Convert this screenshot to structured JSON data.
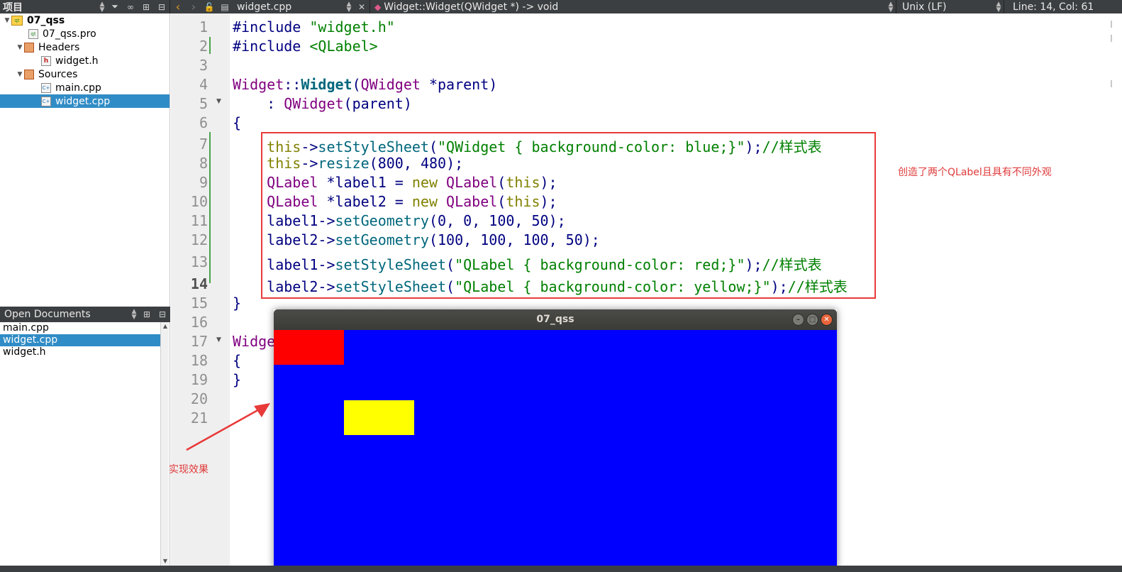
{
  "toolbar": {
    "project_title": "项目",
    "file_name": "widget.cpp",
    "function_signature": "Widget::Widget(QWidget *) -> void",
    "line_ending": "Unix (LF)",
    "cursor_position": "Line: 14, Col: 61"
  },
  "project_tree": {
    "items": [
      {
        "label": "07_qss",
        "level": 0,
        "expanded": true,
        "kind": "project",
        "bold": true
      },
      {
        "label": "07_qss.pro",
        "level": 1,
        "kind": "pro"
      },
      {
        "label": "Headers",
        "level": 1,
        "expanded": true,
        "kind": "folder"
      },
      {
        "label": "widget.h",
        "level": 2,
        "kind": "header"
      },
      {
        "label": "Sources",
        "level": 1,
        "expanded": true,
        "kind": "folder"
      },
      {
        "label": "main.cpp",
        "level": 2,
        "kind": "source"
      },
      {
        "label": "widget.cpp",
        "level": 2,
        "kind": "source",
        "selected": true
      }
    ]
  },
  "open_documents": {
    "title": "Open Documents",
    "items": [
      {
        "label": "main.cpp"
      },
      {
        "label": "widget.cpp",
        "selected": true
      },
      {
        "label": "widget.h"
      }
    ]
  },
  "editor": {
    "current_line": 14,
    "lines": [
      {
        "n": "1",
        "tokens": [
          [
            "macro",
            "#include "
          ],
          [
            "str",
            "\"widget.h\""
          ]
        ]
      },
      {
        "n": "2",
        "tokens": [
          [
            "macro",
            "#include "
          ],
          [
            "str",
            "<QLabel>"
          ]
        ]
      },
      {
        "n": "3",
        "tokens": []
      },
      {
        "n": "4",
        "tokens": [
          [
            "type",
            "Widget"
          ],
          [
            "plain",
            "::"
          ],
          [
            "fnb",
            "Widget"
          ],
          [
            "plain",
            "("
          ],
          [
            "type",
            "QWidget"
          ],
          [
            "plain",
            " *parent)"
          ]
        ]
      },
      {
        "n": "5",
        "tokens": [
          [
            "plain",
            "    : "
          ],
          [
            "type",
            "QWidget"
          ],
          [
            "plain",
            "(parent)"
          ]
        ]
      },
      {
        "n": "6",
        "tokens": [
          [
            "plain",
            "{"
          ]
        ]
      },
      {
        "n": "7",
        "tokens": [
          [
            "kw",
            "    this"
          ],
          [
            "plain",
            "->"
          ],
          [
            "fn",
            "setStyleSheet"
          ],
          [
            "plain",
            "("
          ],
          [
            "str",
            "\"QWidget { background-color: blue;}\""
          ],
          [
            "plain",
            ");"
          ],
          [
            "cm",
            "//样式表"
          ]
        ]
      },
      {
        "n": "8",
        "tokens": [
          [
            "kw",
            "    this"
          ],
          [
            "plain",
            "->"
          ],
          [
            "fn",
            "resize"
          ],
          [
            "plain",
            "("
          ],
          [
            "num",
            "800"
          ],
          [
            "plain",
            ", "
          ],
          [
            "num",
            "480"
          ],
          [
            "plain",
            ");"
          ]
        ]
      },
      {
        "n": "9",
        "tokens": [
          [
            "type",
            "    QLabel"
          ],
          [
            "plain",
            " *label1 = "
          ],
          [
            "kw",
            "new "
          ],
          [
            "type",
            "QLabel"
          ],
          [
            "plain",
            "("
          ],
          [
            "kw",
            "this"
          ],
          [
            "plain",
            ");"
          ]
        ]
      },
      {
        "n": "10",
        "tokens": [
          [
            "type",
            "    QLabel"
          ],
          [
            "plain",
            " *label2 = "
          ],
          [
            "kw",
            "new "
          ],
          [
            "type",
            "QLabel"
          ],
          [
            "plain",
            "("
          ],
          [
            "kw",
            "this"
          ],
          [
            "plain",
            ");"
          ]
        ]
      },
      {
        "n": "11",
        "tokens": [
          [
            "plain",
            "    label1->"
          ],
          [
            "fn",
            "setGeometry"
          ],
          [
            "plain",
            "("
          ],
          [
            "num",
            "0"
          ],
          [
            "plain",
            ", "
          ],
          [
            "num",
            "0"
          ],
          [
            "plain",
            ", "
          ],
          [
            "num",
            "100"
          ],
          [
            "plain",
            ", "
          ],
          [
            "num",
            "50"
          ],
          [
            "plain",
            ");"
          ]
        ]
      },
      {
        "n": "12",
        "tokens": [
          [
            "plain",
            "    label2->"
          ],
          [
            "fn",
            "setGeometry"
          ],
          [
            "plain",
            "("
          ],
          [
            "num",
            "100"
          ],
          [
            "plain",
            ", "
          ],
          [
            "num",
            "100"
          ],
          [
            "plain",
            ", "
          ],
          [
            "num",
            "100"
          ],
          [
            "plain",
            ", "
          ],
          [
            "num",
            "50"
          ],
          [
            "plain",
            ");"
          ]
        ]
      },
      {
        "n": "13",
        "tokens": [
          [
            "plain",
            "    label1->"
          ],
          [
            "fn",
            "setStyleSheet"
          ],
          [
            "plain",
            "("
          ],
          [
            "str",
            "\"QLabel { background-color: red;}\""
          ],
          [
            "plain",
            ");"
          ],
          [
            "cm",
            "//样式表"
          ]
        ]
      },
      {
        "n": "14",
        "tokens": [
          [
            "plain",
            "    label2->"
          ],
          [
            "fn",
            "setStyleSheet"
          ],
          [
            "plain",
            "("
          ],
          [
            "str",
            "\"QLabel { background-color: yellow;}\""
          ],
          [
            "plain",
            ");"
          ],
          [
            "cm",
            "//样式表"
          ]
        ]
      },
      {
        "n": "15",
        "tokens": [
          [
            "plain",
            "}"
          ]
        ]
      },
      {
        "n": "16",
        "tokens": []
      },
      {
        "n": "17",
        "tokens": [
          [
            "type",
            "Widge"
          ]
        ]
      },
      {
        "n": "18",
        "tokens": [
          [
            "plain",
            "{"
          ]
        ]
      },
      {
        "n": "19",
        "tokens": [
          [
            "plain",
            "}"
          ]
        ]
      },
      {
        "n": "20",
        "tokens": []
      },
      {
        "n": "21",
        "tokens": []
      }
    ]
  },
  "annotations": {
    "right_note": "创造了两个QLabel且具有不同外观",
    "left_note": "实现效果",
    "color": "#e03a3a"
  },
  "app_window": {
    "title": "07_qss",
    "background": "#0000ff",
    "labels": [
      {
        "name": "label1",
        "color": "#ff0000"
      },
      {
        "name": "label2",
        "color": "#ffff00"
      }
    ]
  },
  "colors": {
    "selection": "#308cc6",
    "toolbar_bg": "#3c3f41"
  }
}
